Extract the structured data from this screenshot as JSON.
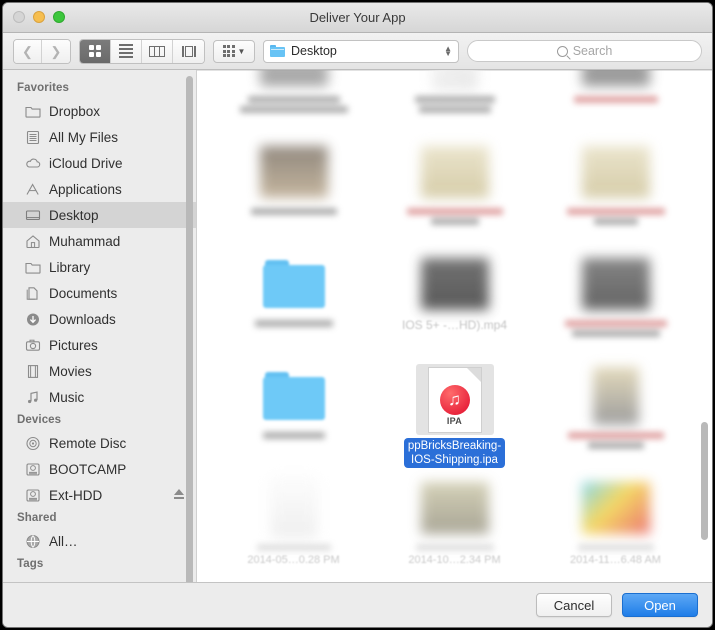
{
  "window": {
    "title": "Deliver Your App",
    "traffic_lights": [
      "close-button",
      "minimize-button",
      "maximize-button"
    ]
  },
  "toolbar": {
    "back_icon": "chevron-left-icon",
    "forward_icon": "chevron-right-icon",
    "view_modes": [
      {
        "name": "icon-view",
        "selected": true
      },
      {
        "name": "list-view",
        "selected": false
      },
      {
        "name": "column-view",
        "selected": false
      },
      {
        "name": "coverflow-view",
        "selected": false
      }
    ],
    "arrange_label": "",
    "path_label": "Desktop",
    "search_placeholder": "Search"
  },
  "sidebar": {
    "sections": [
      {
        "header": "Favorites",
        "items": [
          {
            "label": "Dropbox",
            "icon": "folder-icon"
          },
          {
            "label": "All My Files",
            "icon": "all-files-icon"
          },
          {
            "label": "iCloud Drive",
            "icon": "cloud-icon"
          },
          {
            "label": "Applications",
            "icon": "applications-icon"
          },
          {
            "label": "Desktop",
            "icon": "desktop-icon",
            "active": true
          },
          {
            "label": "Muhammad",
            "icon": "home-icon"
          },
          {
            "label": "Library",
            "icon": "folder-icon"
          },
          {
            "label": "Documents",
            "icon": "documents-icon"
          },
          {
            "label": "Downloads",
            "icon": "downloads-icon"
          },
          {
            "label": "Pictures",
            "icon": "pictures-icon"
          },
          {
            "label": "Movies",
            "icon": "movies-icon"
          },
          {
            "label": "Music",
            "icon": "music-icon"
          }
        ]
      },
      {
        "header": "Devices",
        "items": [
          {
            "label": "Remote Disc",
            "icon": "disc-icon"
          },
          {
            "label": "BOOTCAMP",
            "icon": "harddisk-icon"
          },
          {
            "label": "Ext-HDD",
            "icon": "harddisk-icon",
            "eject": true
          }
        ]
      },
      {
        "header": "Shared",
        "items": [
          {
            "label": "All…",
            "icon": "network-icon"
          }
        ]
      },
      {
        "header": "Tags",
        "items": []
      }
    ]
  },
  "files": {
    "selected_file": {
      "name_line1": "ppBricksBreaking-",
      "name_line2": "IOS-Shipping.ipa",
      "icon": "ipa-document-icon",
      "icon_badge": "IPA"
    },
    "visible_labels": {
      "mp4_item": "IOS 5+ -…HD).mp4",
      "date_1": "2014-05…0.28 PM",
      "date_2": "2014-10…2.34 PM",
      "date_3": "2014-11…6.48 AM"
    }
  },
  "footer": {
    "cancel_label": "Cancel",
    "open_label": "Open"
  },
  "colors": {
    "selection_blue": "#2b6fd8",
    "primary_button": "#1f7de8",
    "folder_blue": "#6ec9f7"
  }
}
